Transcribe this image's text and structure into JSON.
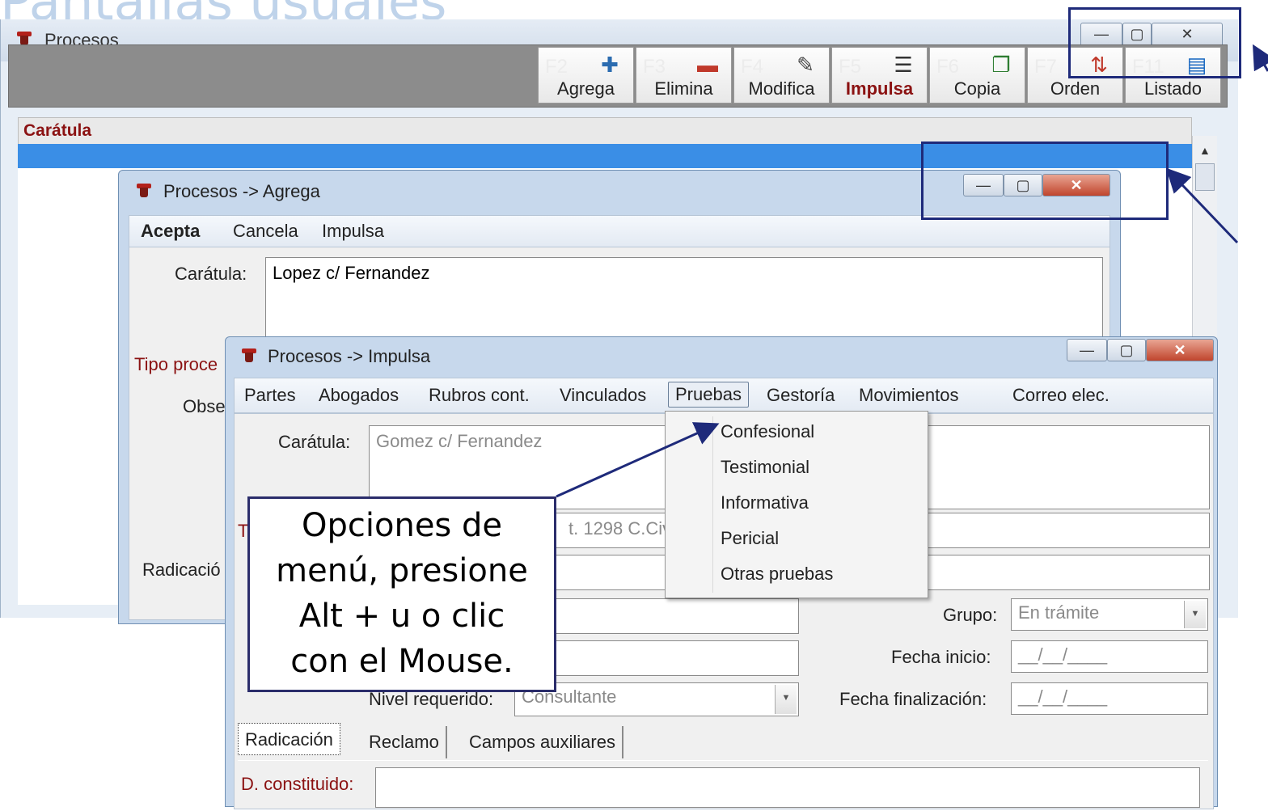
{
  "slide": {
    "title_fragment": "Pantallas usuales"
  },
  "main_window": {
    "title": "Procesos",
    "toolbar": [
      {
        "key": "F2",
        "label": "Agrega",
        "icon": "add-document-icon"
      },
      {
        "key": "F3",
        "label": "Elimina",
        "icon": "delete-document-icon"
      },
      {
        "key": "F4",
        "label": "Modifica",
        "icon": "edit-document-icon"
      },
      {
        "key": "F5",
        "label": "Impulsa",
        "icon": "list-icon",
        "active": true
      },
      {
        "key": "F6",
        "label": "Copia",
        "icon": "copy-icon"
      },
      {
        "key": "F7",
        "label": "Orden",
        "icon": "sort-icon"
      },
      {
        "key": "F11",
        "label": "Listado",
        "icon": "report-icon"
      }
    ],
    "column_header": "Carátula",
    "window_buttons": {
      "minimize": "—",
      "maximize": "▢",
      "close": "✕"
    }
  },
  "agrega_window": {
    "title": "Procesos -> Agrega",
    "menu": {
      "accept": "Acepta",
      "cancel": "Cancela",
      "impulse": "Impulsa"
    },
    "caratula_label": "Carátula:",
    "caratula_value": "Lopez c/ Fernandez",
    "tipo_label": "Tipo proce",
    "obs_label": "Obse",
    "radicacion_tab": "Radicació"
  },
  "impulsa_window": {
    "title": "Procesos -> Impulsa",
    "menu": [
      "Partes",
      "Abogados",
      "Rubros cont.",
      "Vinculados",
      "Pruebas",
      "Gestoría",
      "Movimientos",
      "Correo elec."
    ],
    "caratula_label": "Carátula:",
    "caratula_value": "Gomez c/ Fernandez",
    "t_label": "T",
    "tipo_value_partial": "t. 1298 C.Civ",
    "nivel_label": "Nivel requerido:",
    "nivel_value": "Consultante",
    "grupo_label": "Grupo:",
    "grupo_value": "En trámite",
    "fecha_inicio_label": "Fecha inicio:",
    "fecha_inicio_value": "__/__/____",
    "fecha_fin_label": "Fecha finalización:",
    "fecha_fin_value": "__/__/____",
    "tabs": [
      "Radicación",
      "Reclamo",
      "Campos auxiliares"
    ],
    "d_constituido_label": "D. constituido:"
  },
  "pruebas_dropdown": [
    "Confesional",
    "Testimonial",
    "Informativa",
    "Pericial",
    "Otras pruebas"
  ],
  "callout": {
    "lines": [
      "Opciones de",
      "menú, presione",
      "Alt + u o clic",
      "con el Mouse."
    ]
  },
  "colors": {
    "accent_red": "#8b1212",
    "selection_blue": "#3a8ee6",
    "annotation_navy": "#1e2a7a"
  }
}
